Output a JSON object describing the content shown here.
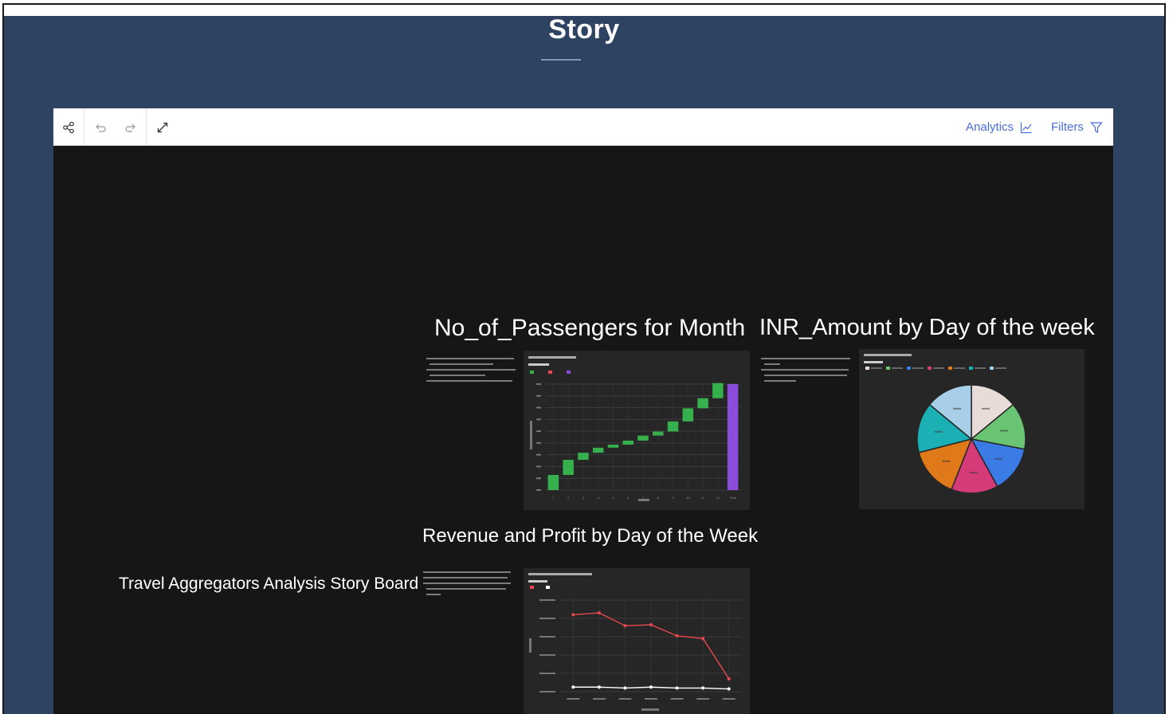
{
  "page": {
    "title": "Story"
  },
  "toolbar": {
    "analytics_label": "Analytics",
    "filters_label": "Filters",
    "icons": [
      "share-icon",
      "undo-icon",
      "redo-icon",
      "expand-icon",
      "analytics-chart-icon",
      "filter-icon"
    ]
  },
  "story": {
    "board_title": "Travel Aggregators Analysis Story Board",
    "charts": [
      {
        "heading": "No_of_Passengers for Month",
        "type": "waterfall",
        "x_values": [
          1,
          2,
          3,
          4,
          5,
          6,
          7,
          8,
          9,
          10,
          11,
          12,
          "Total"
        ]
      },
      {
        "heading": "INR_Amount by Day of the week",
        "type": "pie"
      },
      {
        "heading": "Revenue and Profit by Day of the Week",
        "type": "line"
      }
    ]
  },
  "chart_data": [
    {
      "type": "bar",
      "title": "No_of_Passengers for Month",
      "categories": [
        "1",
        "2",
        "3",
        "4",
        "5",
        "6",
        "7",
        "8",
        "9",
        "10",
        "11",
        "12",
        "Total"
      ],
      "series": [
        {
          "values": [
            1.5,
            1.5,
            0.7,
            0.5,
            0.3,
            0.4,
            0.5,
            0.4,
            1.0,
            1.3,
            1.0,
            1.5,
            10.5
          ]
        }
      ]
    },
    {
      "type": "pie",
      "title": "INR_Amount by Day of the week",
      "values": [
        14,
        14,
        14,
        14,
        15,
        15,
        14
      ],
      "colors": [
        "#e8dcd8",
        "#69c473",
        "#3a7be6",
        "#d63b79",
        "#e0791a",
        "#1bb0b4",
        "#a8cfe8"
      ]
    },
    {
      "type": "line",
      "title": "Revenue and Profit by Day of the Week",
      "series": [
        {
          "values": [
            8.4,
            8.6,
            7.2,
            7.3,
            6.1,
            5.8,
            1.4
          ],
          "color": "#e8474d"
        },
        {
          "values": [
            0.5,
            0.5,
            0.4,
            0.5,
            0.4,
            0.4,
            0.3
          ],
          "color": "#ffffff"
        }
      ],
      "ylim": [
        0,
        10
      ]
    }
  ]
}
